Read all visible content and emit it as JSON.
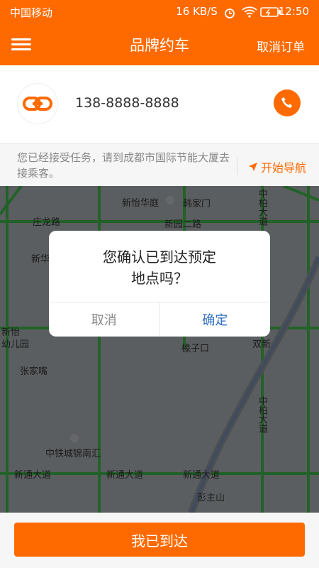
{
  "status": {
    "carrier": "中国移动",
    "speed": "16 KB/S",
    "time": "12:50"
  },
  "nav": {
    "title": "品牌约车",
    "cancel_order": "取消订单"
  },
  "driver": {
    "phone": "138-8888-8888"
  },
  "notice": {
    "message": "您已经接受任务，请到成都市国际节能大厦去接乘客。",
    "start_nav": "开始导航"
  },
  "map": {
    "labels": {
      "l1": "新怡华庭",
      "l2": "韩家门",
      "l3": "庄龙路",
      "l4": "新园二路",
      "l5": "新华",
      "l6": "新怡",
      "l7": "幼儿园",
      "l8": "张家嘴",
      "l9": "中铁城锦南汇",
      "l10": "新通大道",
      "l11": "新通大道",
      "l12": "新通大道",
      "l13": "彭主山",
      "l14": "中柏大道",
      "l15": "中柏大道",
      "l16": "椽子口",
      "l17": "双新"
    }
  },
  "dialog": {
    "line1": "您确认已到达预定",
    "line2": "地点吗？",
    "cancel": "取消",
    "confirm": "确定"
  },
  "bottom": {
    "arrived": "我已到达"
  }
}
